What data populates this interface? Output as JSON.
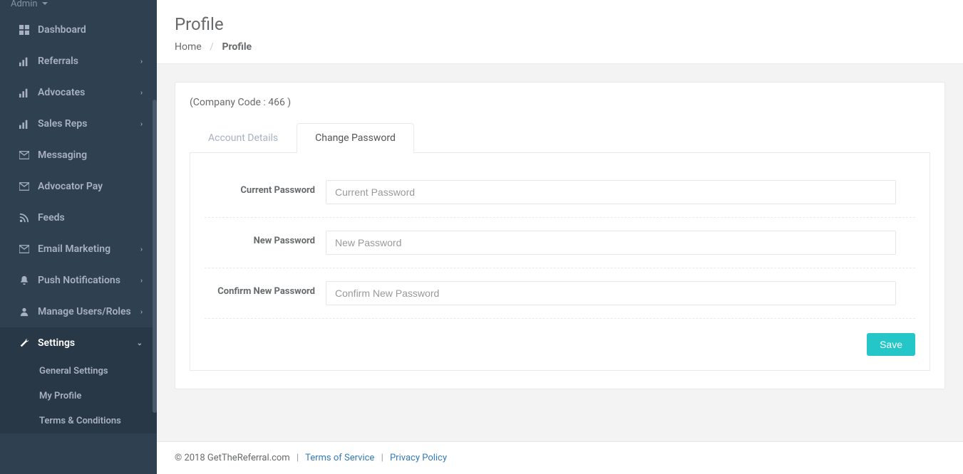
{
  "topbar": {
    "admin_label": "Admin"
  },
  "sidebar": {
    "items": [
      {
        "label": "Dashboard"
      },
      {
        "label": "Referrals"
      },
      {
        "label": "Advocates"
      },
      {
        "label": "Sales Reps"
      },
      {
        "label": "Messaging"
      },
      {
        "label": "Advocator Pay"
      },
      {
        "label": "Feeds"
      },
      {
        "label": "Email Marketing"
      },
      {
        "label": "Push Notifications"
      },
      {
        "label": "Manage Users/Roles"
      },
      {
        "label": "Settings"
      }
    ],
    "settings_submenu": [
      {
        "label": "General Settings"
      },
      {
        "label": "My Profile"
      },
      {
        "label": "Terms & Conditions"
      }
    ]
  },
  "header": {
    "title": "Profile",
    "breadcrumb_home": "Home",
    "breadcrumb_current": "Profile"
  },
  "panel": {
    "company_code_text": "(Company Code : 466 )",
    "tabs": {
      "account_details": "Account Details",
      "change_password": "Change Password"
    },
    "form": {
      "current_password_label": "Current Password",
      "current_password_placeholder": "Current Password",
      "new_password_label": "New Password",
      "new_password_placeholder": "New Password",
      "confirm_password_label": "Confirm New Password",
      "confirm_password_placeholder": "Confirm New Password",
      "save_label": "Save"
    }
  },
  "footer": {
    "copyright": "© 2018 GetTheReferral.com",
    "terms": "Terms of Service",
    "privacy": "Privacy Policy"
  }
}
